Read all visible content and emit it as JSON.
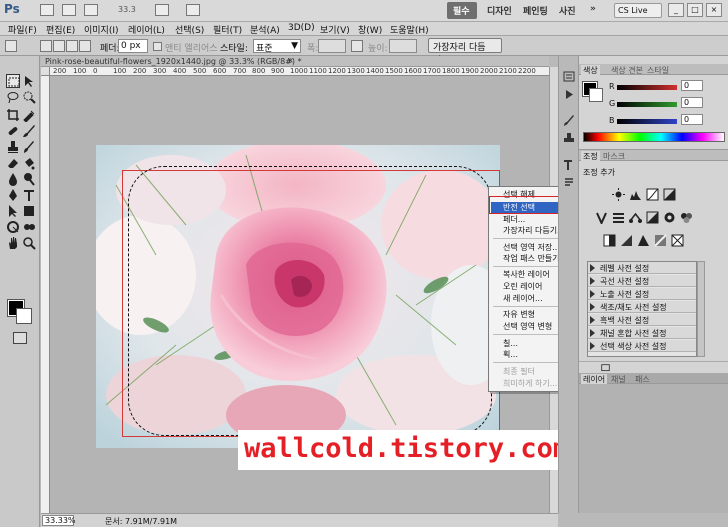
{
  "app": {
    "logo": "Ps",
    "zoom_readout": "33.3",
    "workspaces": [
      "필수",
      "디자인",
      "페인팅",
      "사진"
    ],
    "more": "»",
    "cs_live": "CS Live"
  },
  "menubar": {
    "items": [
      "파일(F)",
      "편집(E)",
      "이미지(I)",
      "레이어(L)",
      "선택(S)",
      "필터(T)",
      "분석(A)",
      "3D(D)",
      "보기(V)",
      "창(W)",
      "도움말(H)"
    ]
  },
  "options": {
    "feather_label": "페더:",
    "feather_value": "0 px",
    "antialias_label": "앤티 앨리어스",
    "style_label": "스타일:",
    "style_value": "표준",
    "width_label": "폭:",
    "height_label": "높이:",
    "refine_button": "가장자리 다듬기..."
  },
  "document": {
    "tab_title": "Pink-rose-beautiful-flowers_1920x1440.jpg @ 33.3% (RGB/8#) *",
    "ruler_ticks": [
      "200",
      "100",
      "0",
      "100",
      "200",
      "300",
      "400",
      "500",
      "600",
      "700",
      "800",
      "900",
      "1000",
      "1100",
      "1200",
      "1300",
      "1400",
      "1500",
      "1600",
      "1700",
      "1800",
      "1900",
      "2000",
      "2100",
      "2200"
    ],
    "status_zoom": "33.33%",
    "status_doc": "문서: 7.91M/7.91M"
  },
  "context_menu": {
    "items": [
      {
        "label": "선택 해제",
        "disabled": false
      },
      {
        "label": "반전 선택",
        "disabled": false,
        "highlighted": true
      },
      {
        "label": "페더...",
        "disabled": false
      },
      {
        "label": "가장자리 다듬기...",
        "disabled": false
      },
      {
        "label": "선택 영역 저장...",
        "disabled": false
      },
      {
        "label": "작업 패스 만들기...",
        "disabled": false
      },
      {
        "label": "복사한 레이어",
        "disabled": false
      },
      {
        "label": "오린 레이어",
        "disabled": false
      },
      {
        "label": "새 레이어...",
        "disabled": false
      },
      {
        "label": "자유 변형",
        "disabled": false
      },
      {
        "label": "선택 영역 변형",
        "disabled": false
      },
      {
        "label": "칠...",
        "disabled": false
      },
      {
        "label": "획...",
        "disabled": false
      },
      {
        "label": "최종 필터",
        "disabled": true
      },
      {
        "label": "희미하게 하기...",
        "disabled": true
      }
    ]
  },
  "watermark": "wallcold.tistory.com",
  "color_panel": {
    "tabs": [
      "색상",
      "색상 견본",
      "스타일"
    ],
    "channels": [
      {
        "label": "R",
        "value": "0",
        "color": "#d03030"
      },
      {
        "label": "G",
        "value": "0",
        "color": "#2f9a2f"
      },
      {
        "label": "B",
        "value": "0",
        "color": "#2f44c8"
      }
    ]
  },
  "adjust_panel": {
    "tabs": [
      "조정",
      "마스크"
    ],
    "title": "조정 추가",
    "presets": [
      "레벨 사전 설정",
      "곡선 사전 설정",
      "노출 사전 설정",
      "색조/채도 사전 설정",
      "흑백 사전 설정",
      "채널 혼합 사전 설정",
      "선택 색상 사전 설정"
    ]
  },
  "layers_panel": {
    "tabs": [
      "레이어",
      "채널",
      "패스"
    ]
  }
}
